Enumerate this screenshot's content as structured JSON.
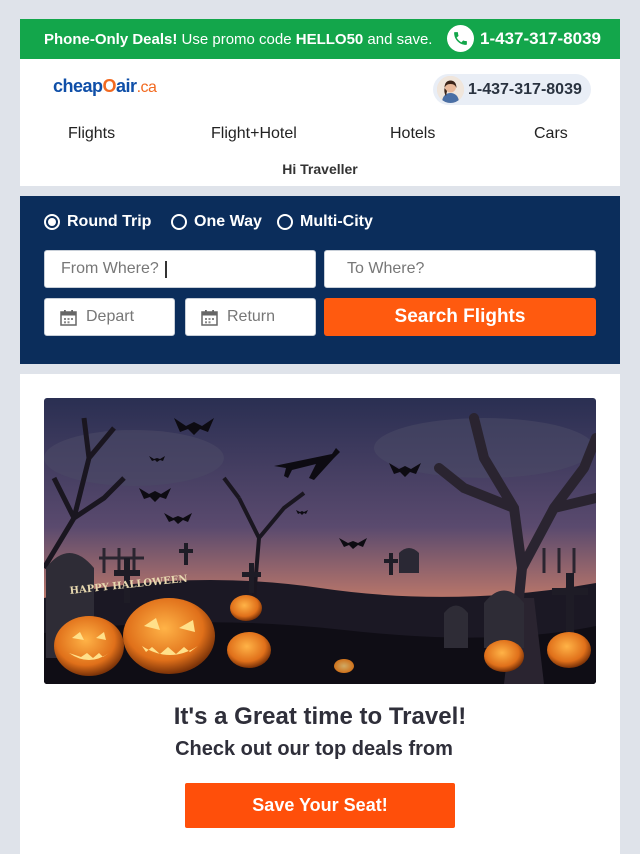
{
  "promo": {
    "deal_label": "Phone-Only Deals!",
    "text_before_code": " Use promo code ",
    "code": "HELLO50",
    "text_after_code": " and save.",
    "phone": "1-437-317-8039",
    "icon": "phone-icon"
  },
  "header": {
    "logo_text_cheap": "cheap",
    "logo_text_o": "O",
    "logo_text_air": "air",
    "logo_text_ca": ".ca",
    "phone": "1-437-317-8039",
    "nav": [
      {
        "label": "Flights"
      },
      {
        "label": "Flight+Hotel"
      },
      {
        "label": "Hotels"
      },
      {
        "label": "Cars"
      }
    ],
    "greeting": "Hi Traveller"
  },
  "search": {
    "trip_types": [
      {
        "label": "Round Trip",
        "selected": true
      },
      {
        "label": "One Way",
        "selected": false
      },
      {
        "label": "Multi-City",
        "selected": false
      }
    ],
    "from_placeholder": "From Where?",
    "to_placeholder": "To Where?",
    "depart_placeholder": "Depart",
    "return_placeholder": "Return",
    "button_label": "Search Flights",
    "accent": "#ff5a0f",
    "panel_color": "#0b2d5b"
  },
  "content": {
    "hero_sign_text": "HAPPY HALLOWEEN",
    "headline": "It's a Great time to Travel!",
    "subline": "Check out our top deals from",
    "cta_label": "Save Your Seat!"
  }
}
